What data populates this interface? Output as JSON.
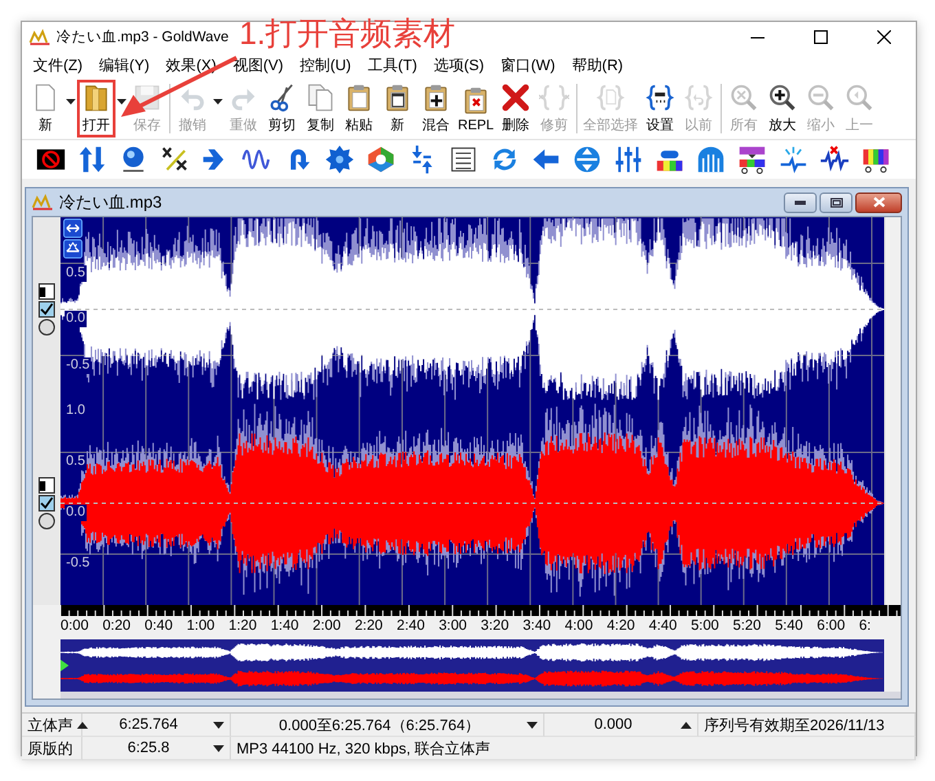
{
  "window": {
    "title": "冷たい血.mp3 - GoldWave"
  },
  "annotation": {
    "text": "1.打开音频素材"
  },
  "menu": [
    "文件(Z)",
    "编辑(Y)",
    "效果(X)",
    "视图(V)",
    "控制(U)",
    "工具(T)",
    "选项(S)",
    "窗口(W)",
    "帮助(R)"
  ],
  "toolbar": [
    [
      {
        "label": "新",
        "disabled": false,
        "has_menu": true,
        "highlighted": false
      },
      {
        "label": "打开",
        "disabled": false,
        "has_menu": true,
        "highlighted": true
      },
      {
        "label": "保存",
        "disabled": true,
        "has_menu": false,
        "highlighted": false
      }
    ],
    [
      {
        "label": "撤销",
        "disabled": true,
        "has_menu": true,
        "highlighted": false
      },
      {
        "label": "重做",
        "disabled": true,
        "has_menu": false,
        "highlighted": false
      },
      {
        "label": "剪切",
        "disabled": false,
        "has_menu": false,
        "highlighted": false
      },
      {
        "label": "复制",
        "disabled": false,
        "has_menu": false,
        "highlighted": false
      },
      {
        "label": "粘贴",
        "disabled": false,
        "has_menu": false,
        "highlighted": false
      },
      {
        "label": "新",
        "disabled": false,
        "has_menu": false,
        "highlighted": false
      },
      {
        "label": "混合",
        "disabled": false,
        "has_menu": false,
        "highlighted": false
      },
      {
        "label": "REPL",
        "disabled": false,
        "has_menu": false,
        "highlighted": false
      },
      {
        "label": "删除",
        "disabled": false,
        "has_menu": false,
        "highlighted": false
      },
      {
        "label": "修剪",
        "disabled": true,
        "has_menu": false,
        "highlighted": false
      }
    ],
    [
      {
        "label": "全部选择",
        "disabled": true,
        "has_menu": false,
        "highlighted": false
      },
      {
        "label": "设置",
        "disabled": false,
        "has_menu": false,
        "highlighted": false
      },
      {
        "label": "以前",
        "disabled": true,
        "has_menu": false,
        "highlighted": false
      }
    ],
    [
      {
        "label": "所有",
        "disabled": true,
        "has_menu": false,
        "highlighted": false
      },
      {
        "label": "放大",
        "disabled": false,
        "has_menu": false,
        "highlighted": false
      },
      {
        "label": "缩小",
        "disabled": true,
        "has_menu": false,
        "highlighted": false
      },
      {
        "label": "上一",
        "disabled": true,
        "has_menu": false,
        "highlighted": false
      }
    ]
  ],
  "document": {
    "title": "冷たい血.mp3",
    "channels": [
      {
        "color": "#ffffff",
        "checked": true,
        "selected": false,
        "axis_labels": [
          "0.5",
          "0.0",
          "-0.5"
        ]
      },
      {
        "color": "#ff0000",
        "checked": true,
        "selected": false,
        "axis_labels": [
          "1.0",
          "0.5",
          "0.0",
          "-0.5"
        ]
      }
    ],
    "timeline": [
      "0:00",
      "0:20",
      "0:40",
      "1:00",
      "1:20",
      "1:40",
      "2:00",
      "2:20",
      "2:40",
      "3:00",
      "3:20",
      "3:40",
      "4:00",
      "4:20",
      "4:40",
      "5:00",
      "5:20",
      "5:40",
      "6:00",
      "6:"
    ]
  },
  "status_bar": {
    "rows": [
      [
        {
          "text": "立体声",
          "caret_up": true,
          "caret_down": false
        },
        {
          "text": "6:25.764",
          "caret_up": false,
          "caret_down": true
        },
        {
          "text": "0.000至6:25.764（6:25.764）",
          "caret_up": false,
          "caret_down": true
        },
        {
          "text": "0.000",
          "caret_up": true,
          "caret_down": false
        },
        {
          "text": "序列号有效期至2026/11/13",
          "caret_up": false,
          "caret_down": false
        }
      ],
      [
        {
          "text": "原版的",
          "caret_up": false,
          "caret_down": false
        },
        {
          "text": "6:25.8",
          "caret_up": false,
          "caret_down": true
        },
        {
          "text": "MP3 44100 Hz, 320 kbps, 联合立体声",
          "caret_up": false,
          "caret_down": false
        }
      ]
    ]
  }
}
